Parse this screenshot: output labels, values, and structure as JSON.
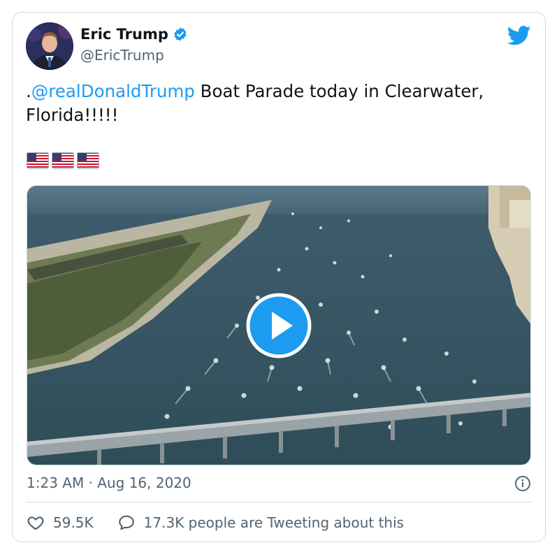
{
  "author": {
    "name": "Eric Trump",
    "handle": "@EricTrump"
  },
  "tweet": {
    "prefix": ".",
    "mention": "@realDonaldTrump",
    "text": " Boat Parade today in Clearwater, Florida!!!!!",
    "flags": [
      "us-flag-icon",
      "us-flag-icon",
      "us-flag-icon"
    ]
  },
  "timestamp": "1:23 AM · Aug 16, 2020",
  "stats": {
    "likes": "59.5K",
    "tweeting": "17.3K people are Tweeting about this"
  },
  "colors": {
    "accent": "#1d9bf0",
    "secondary_text": "#536471",
    "border": "#cfd9de",
    "like_icon": "#536471"
  },
  "icons": [
    "verified-badge-icon",
    "twitter-bird-icon",
    "play-icon",
    "info-icon",
    "heart-icon",
    "speech-bubble-icon"
  ]
}
